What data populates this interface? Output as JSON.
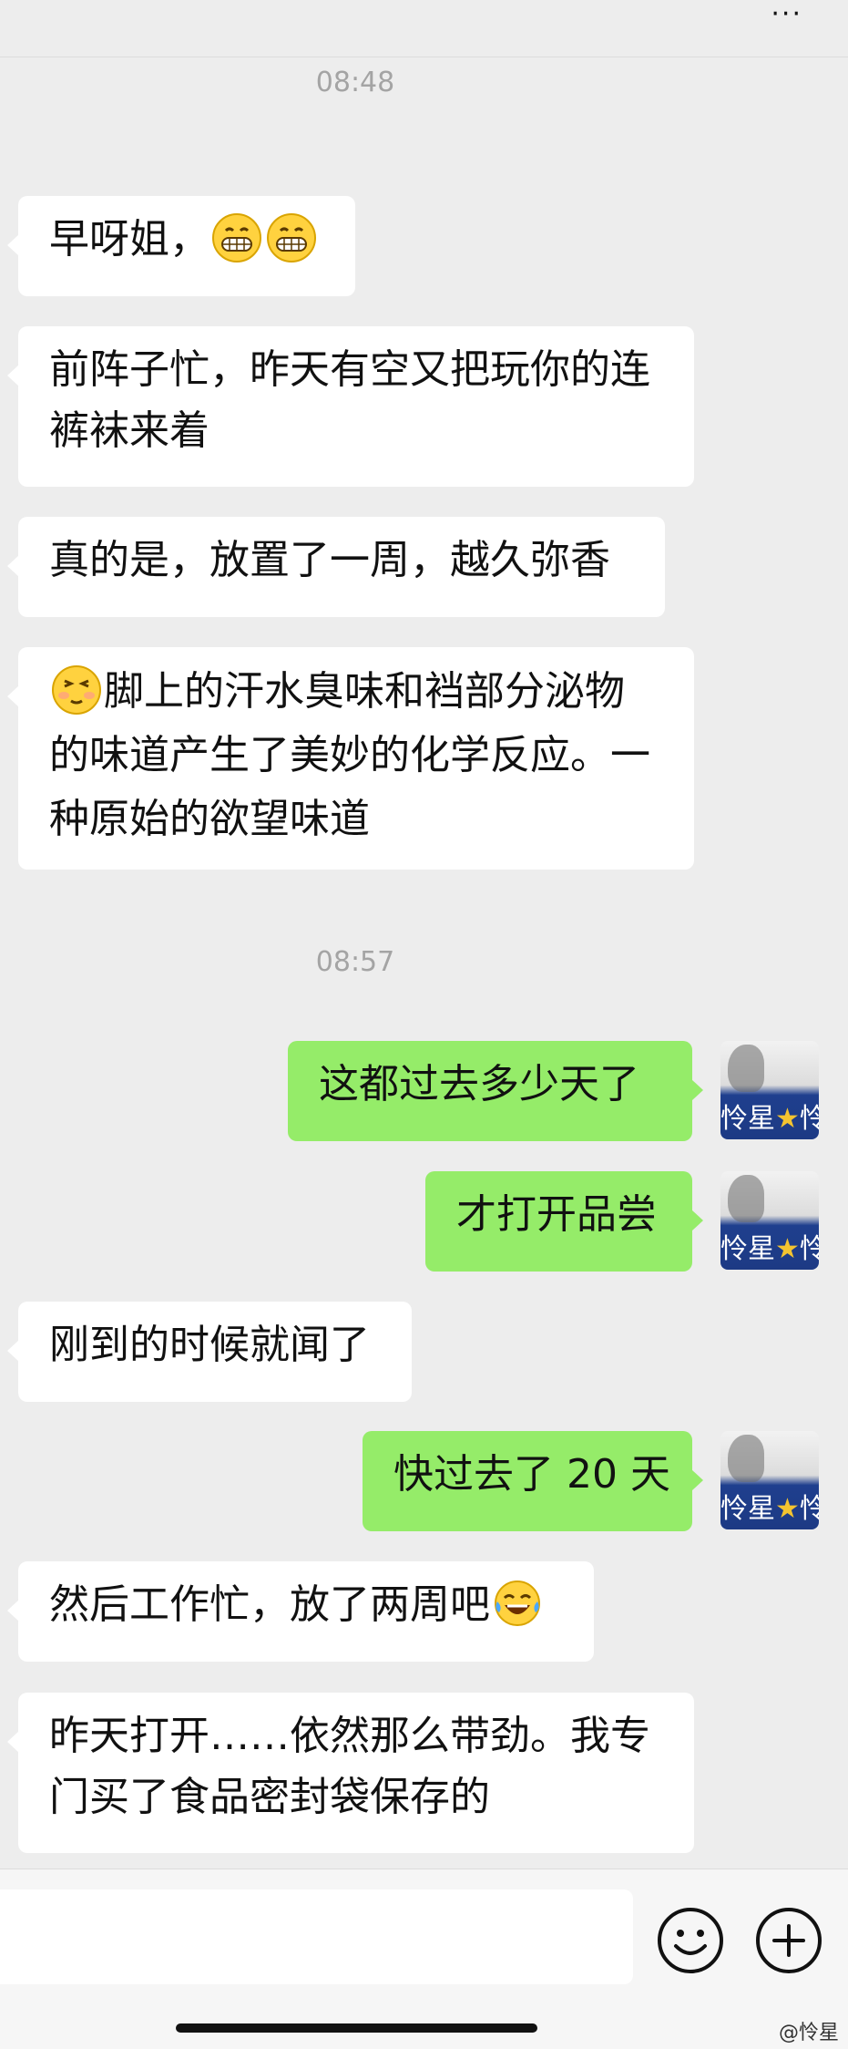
{
  "header": {
    "more_label": "···"
  },
  "timestamps": [
    "08:48",
    "08:57"
  ],
  "messages": [
    {
      "from": "them",
      "lines": [
        "早呀姐，[grin][grin]"
      ]
    },
    {
      "from": "them",
      "lines": [
        "前阵子忙，昨天有空又把玩你的连",
        "裤袜来着"
      ]
    },
    {
      "from": "them",
      "lines": [
        "真的是，放置了一周，越久弥香"
      ]
    },
    {
      "from": "them",
      "lines": [
        "[smug]脚上的汗水臭味和裆部分泌物",
        "的味道产生了美妙的化学反应。一",
        "种原始的欲望味道"
      ]
    },
    {
      "from": "me",
      "lines": [
        "这都过去多少天了"
      ]
    },
    {
      "from": "me",
      "lines": [
        "才打开品尝"
      ]
    },
    {
      "from": "them",
      "lines": [
        "刚到的时候就闻了"
      ]
    },
    {
      "from": "me",
      "lines": [
        "快过去了 20 天"
      ]
    },
    {
      "from": "them",
      "lines": [
        "然后工作忙，放了两周吧[tears]"
      ]
    },
    {
      "from": "them",
      "lines": [
        "昨天打开……依然那么带劲。我专",
        "门买了食品密封袋保存的"
      ]
    }
  ],
  "avatar": {
    "name": "怜星",
    "star": "★",
    "tail": "怜"
  },
  "icons": {
    "emoji_button": "emoji-face-icon",
    "add_button": "plus-circle-icon"
  },
  "colors": {
    "background": "#ededed",
    "incoming_bubble": "#ffffff",
    "outgoing_bubble": "#95ec69"
  },
  "watermark": "@怜星"
}
